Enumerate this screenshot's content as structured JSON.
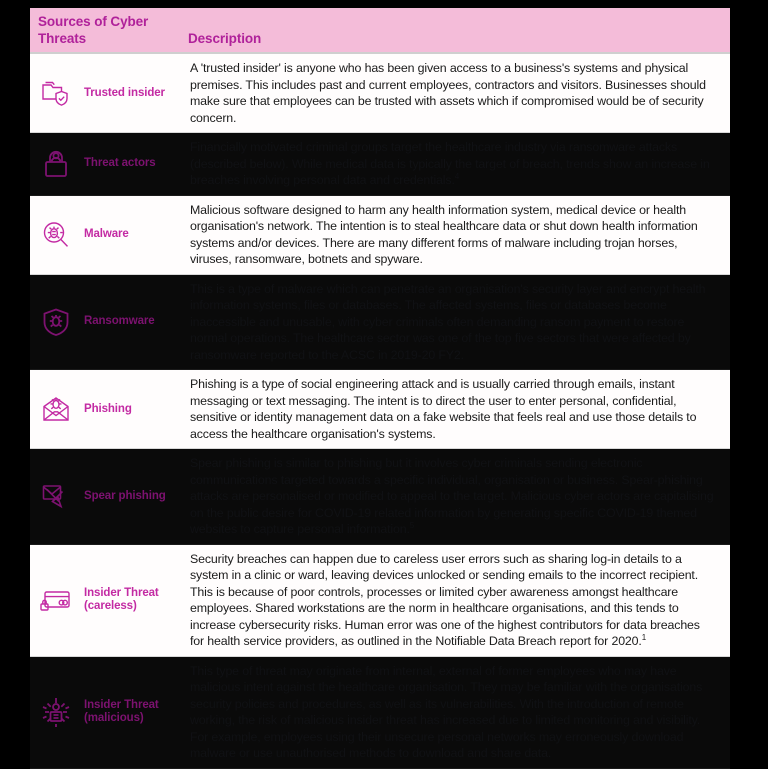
{
  "header": {
    "col_threats": "Sources of\nCyber Threats",
    "col_description": "Description",
    "bg_color": "#f4bcd9",
    "text_color": "#b0219a"
  },
  "theme": {
    "accent": "#c32aa3",
    "accent_dim": "#7d1270",
    "row_light_bg": "#fffdfd",
    "row_dark_bg": "#0a0a0a",
    "page_bg": "#000000",
    "body_text": "#1b1b1b"
  },
  "rows": [
    {
      "icon": "folder-shield-check-icon",
      "label": "Trusted insider",
      "tone": "light",
      "description": " A 'trusted insider' is anyone who has been given access to a business's systems and physical premises. This includes past and current employees, contractors and visitors. Businesses should make sure that employees can be trusted with assets which if compromised would be of security concern."
    },
    {
      "icon": "padlock-person-icon",
      "label": "Threat actors",
      "tone": "dark",
      "description": "Financially motivated criminal groups target the healthcare industry via ransomware attacks (described below). While medical data is typically the target of breach, trends show an increase in breaches involving personal data and credentials.",
      "footnote": "4"
    },
    {
      "icon": "bug-magnifier-icon",
      "label": "Malware",
      "tone": "light",
      "description": "Malicious software designed to harm any health information system, medical device or health organisation's network. The intention is to steal healthcare data or shut down health information systems and/or devices. There are many different forms of malware including trojan horses, viruses, ransomware, botnets and spyware."
    },
    {
      "icon": "shield-bug-icon",
      "label": "Ransomware",
      "tone": "dark",
      "description": "This is a type of malware which can penetrate an organisation's security layer and encrypt health information systems, files or databases. The affected systems, files or databases become inaccessible and unusable, with cyber criminals often demanding ransom payment to restore normal operations. The healthcare sector was one of the top five sectors that were affected by ransomware reported to the ACSC in 2019-20 FY2."
    },
    {
      "icon": "envelope-bug-icon",
      "label": "Phishing",
      "tone": "light",
      "description": "Phishing is a type of social engineering attack and is usually carried through emails, instant messaging or text messaging. The intent is to direct the user to enter personal, confidential, sensitive or identity management data on a fake website that feels real and use those details to access the healthcare organisation's systems."
    },
    {
      "icon": "envelope-arrow-target-icon",
      "label": "Spear phishing",
      "tone": "dark",
      "description": "Spear phishing is similar to phishing but it involves cyber criminals sending electronic communications targeted towards a specific individual, organisation or business. Spear-phishing attacks are personalised or modified to appeal to the target. Malicious cyber actors are capitalising on the public desire for COVID-19 related information by generating specific COVID-19 themed websites to capture personal information.",
      "footnote": "5"
    },
    {
      "icon": "card-padlock-icon",
      "label": "Insider Threat\n(careless)",
      "tone": "light",
      "description": "Security breaches can happen due to careless user errors such as sharing log-in details to a system in a clinic or ward, leaving devices unlocked or sending emails to the incorrect recipient. This is because of poor controls, processes or limited cyber awareness amongst healthcare employees. Shared workstations are the norm in healthcare organisations, and this tends to increase cybersecurity risks. Human error was one of the highest contributors for data breaches for health service providers, as outlined in the Notifiable Data Breach report for 2020.",
      "footnote": "1"
    },
    {
      "icon": "person-network-malicious-icon",
      "label": "Insider Threat\n(malicious)",
      "tone": "dark",
      "description": "This type of threat may originate from internal, external of former employees who may have malicious intent against the healthcare organisation. They may be familiar with the organisations security policies and procedures, as well as its vulnerabilities. With the introduction of remote working, the risk of malicious insider threat has increased due to limited monitoring and visibility. For example, employees using their unsecure personal networks may erroneously download malware or use unauthorised methods to download and share data."
    }
  ]
}
